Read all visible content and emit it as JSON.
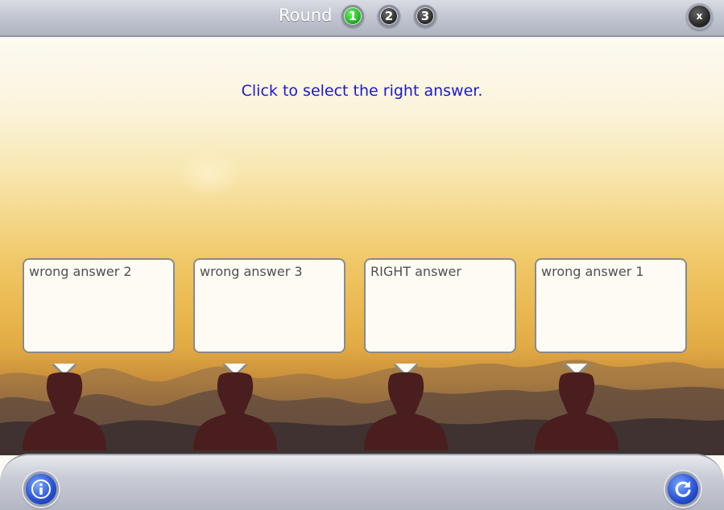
{
  "header": {
    "round_label": "Round",
    "rounds": [
      {
        "label": "1",
        "active": true
      },
      {
        "label": "2",
        "active": false
      },
      {
        "label": "3",
        "active": false
      }
    ],
    "close_label": "x"
  },
  "main": {
    "instruction": "Click to select the right answer.",
    "answers": [
      {
        "label": "wrong answer 2"
      },
      {
        "label": "wrong answer 3"
      },
      {
        "label": "RIGHT answer"
      },
      {
        "label": "wrong answer 1"
      }
    ]
  },
  "footer": {
    "info_icon": "info-icon",
    "restart_icon": "restart-icon"
  },
  "colors": {
    "instruction": "#1a1ad0",
    "active_round": "#1db31f",
    "silhouette": "#4a1e1e"
  }
}
